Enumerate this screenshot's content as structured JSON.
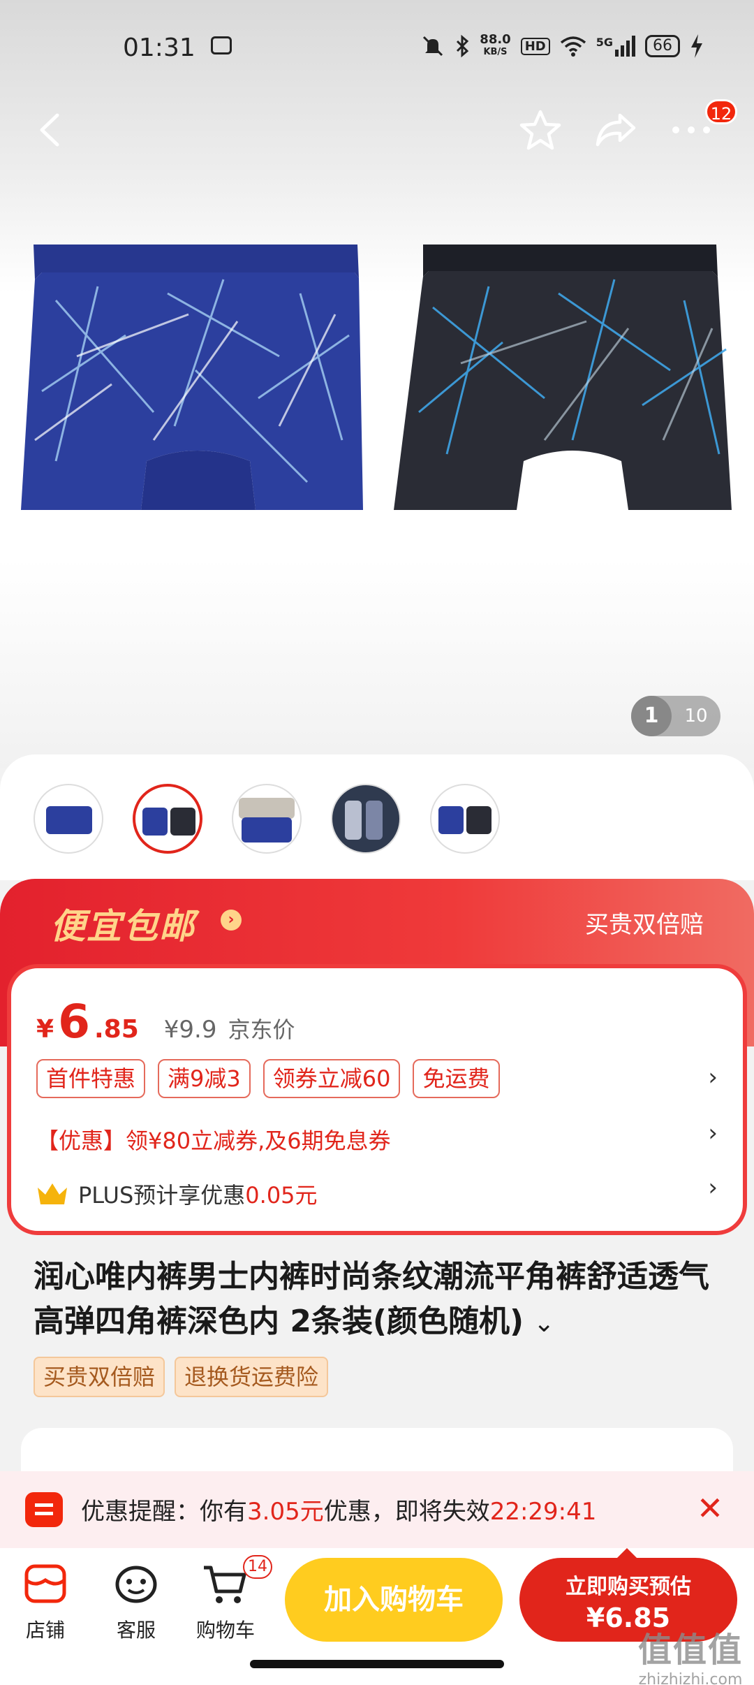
{
  "status_bar": {
    "time": "01:31",
    "net_speed_value": "88.0",
    "net_speed_unit": "KB/S",
    "hd": "HD",
    "signal": "5G",
    "battery": "66"
  },
  "nav": {
    "badge_count": "12"
  },
  "gallery": {
    "current_page": "1",
    "total_pages": "10"
  },
  "promo": {
    "title": "便宜包邮",
    "right_label": "买贵双倍赔",
    "price": {
      "currency": "¥",
      "integer": "6",
      "decimal": ".85",
      "original": "¥9.9",
      "original_label": "京东价"
    },
    "tags": [
      "首件特惠",
      "满9减3",
      "领券立减60",
      "免运费"
    ],
    "coupon_text": "【优惠】领¥80立减券,及6期免息券",
    "plus_prefix": "PLUS预计享优惠",
    "plus_amount": "0.05元"
  },
  "product": {
    "title": "润心唯内裤男士内裤时尚条纹潮流平角裤舒适透气高弹四角裤深色内 2条装(颜色随机)",
    "service_tags": [
      "买贵双倍赔",
      "退换货运费险"
    ]
  },
  "reminder": {
    "prefix": "优惠提醒：你有",
    "amount": "3.05元",
    "middle": "优惠，即将失效",
    "countdown": "22:29:41"
  },
  "bottom_bar": {
    "store_label": "店铺",
    "service_label": "客服",
    "cart_label": "购物车",
    "cart_count": "14",
    "add_to_cart": "加入购物车",
    "buy_now": "立即购买预估",
    "buy_price": "¥6.85"
  },
  "watermark": {
    "line1": "值值值",
    "line2": "zhizhizhi.com"
  },
  "colors": {
    "accent_red": "#e1251b",
    "cart_yellow": "#ffcc1f",
    "promo_gold": "#ffd48a"
  }
}
